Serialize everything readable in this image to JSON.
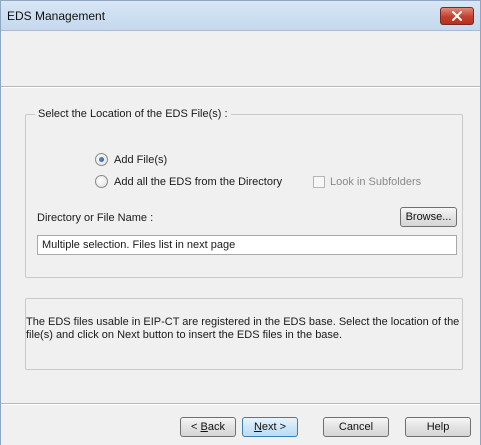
{
  "window": {
    "title": "EDS Management"
  },
  "icons": {
    "close": "close-icon"
  },
  "location_group": {
    "legend": "Select the Location of the EDS File(s) :",
    "options": [
      {
        "label": "Add File(s)",
        "checked": true
      },
      {
        "label": "Add all the EDS from the Directory",
        "checked": false
      }
    ],
    "look_in_subfolders": {
      "label": "Look in Subfolders",
      "checked": false,
      "enabled": false
    },
    "directory_label": "Directory or File Name :",
    "browse_label": "Browse...",
    "directory_value": "Multiple selection. Files list in next page"
  },
  "info": {
    "text": "The EDS files usable in EIP-CT are registered in the EDS base. Select the location of the file(s) and click on Next button to insert the EDS files in the base."
  },
  "footer": {
    "back_prefix": "< ",
    "back_mnemonic": "B",
    "back_rest": "ack",
    "next_mnemonic": "N",
    "next_rest": "ext >",
    "cancel_label": "Cancel",
    "help_label": "Help"
  }
}
